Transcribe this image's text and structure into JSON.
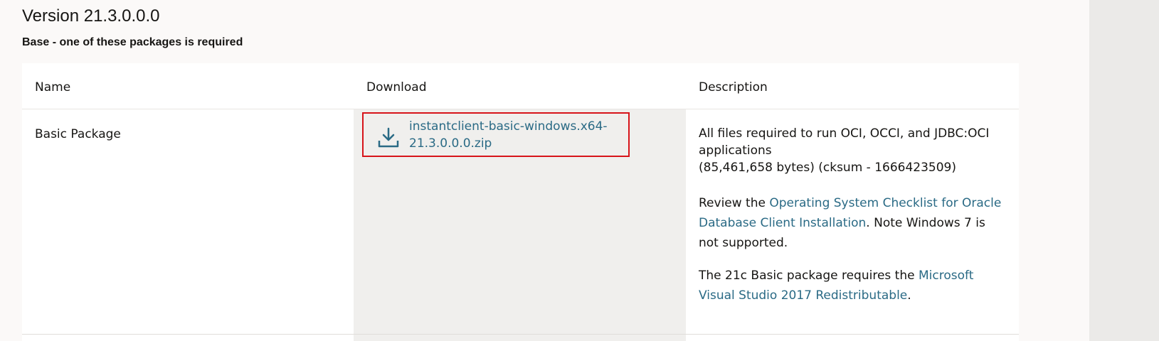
{
  "section": {
    "title": "Version 21.3.0.0.0",
    "subtitle": "Base - one of these packages is required"
  },
  "table": {
    "headers": {
      "name": "Name",
      "download": "Download",
      "description": "Description"
    },
    "rows": [
      {
        "name": "Basic Package",
        "download": {
          "icon": "download-icon",
          "label": "instantclient-basic-windows.x64-21.3.0.0.0.zip"
        },
        "description": {
          "line1": "All files required to run OCI, OCCI, and JDBC:OCI applications",
          "line2": "(85,461,658 bytes) (cksum - 1666423509)",
          "review_prefix": "Review the ",
          "review_link": "Operating System Checklist for Oracle Database Client Installation",
          "review_suffix": ". Note Windows 7 is not supported.",
          "redist_prefix": "The 21c Basic package requires the ",
          "redist_link": "Microsoft Visual Studio 2017 Redistributable",
          "redist_suffix": "."
        }
      }
    ]
  },
  "colors": {
    "link": "#2a6a85",
    "highlight_border": "#d7141a"
  }
}
